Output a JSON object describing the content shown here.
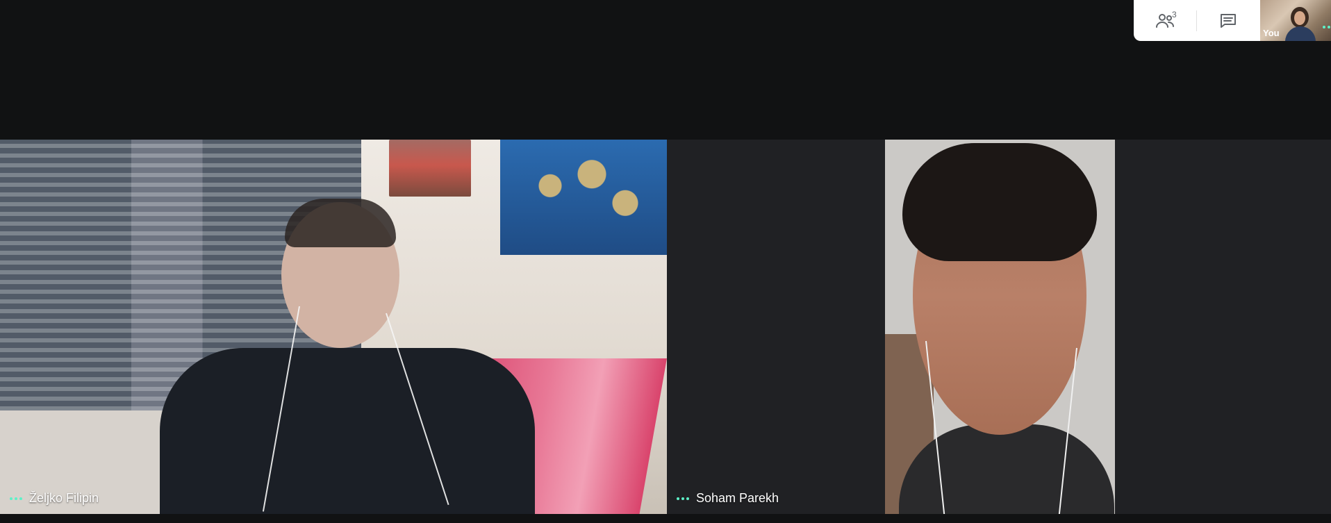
{
  "top_controls": {
    "people_count": "3",
    "people_icon": "people-icon",
    "chat_icon": "chat-icon"
  },
  "self_view": {
    "label": "You",
    "status": "speaking-dots"
  },
  "participants": [
    {
      "name": "Željko Filipin"
    },
    {
      "name": "Soham Parekh"
    }
  ],
  "colors": {
    "app_bg": "#111213",
    "tile_bg": "#202124",
    "accent": "#5ef1c8"
  }
}
